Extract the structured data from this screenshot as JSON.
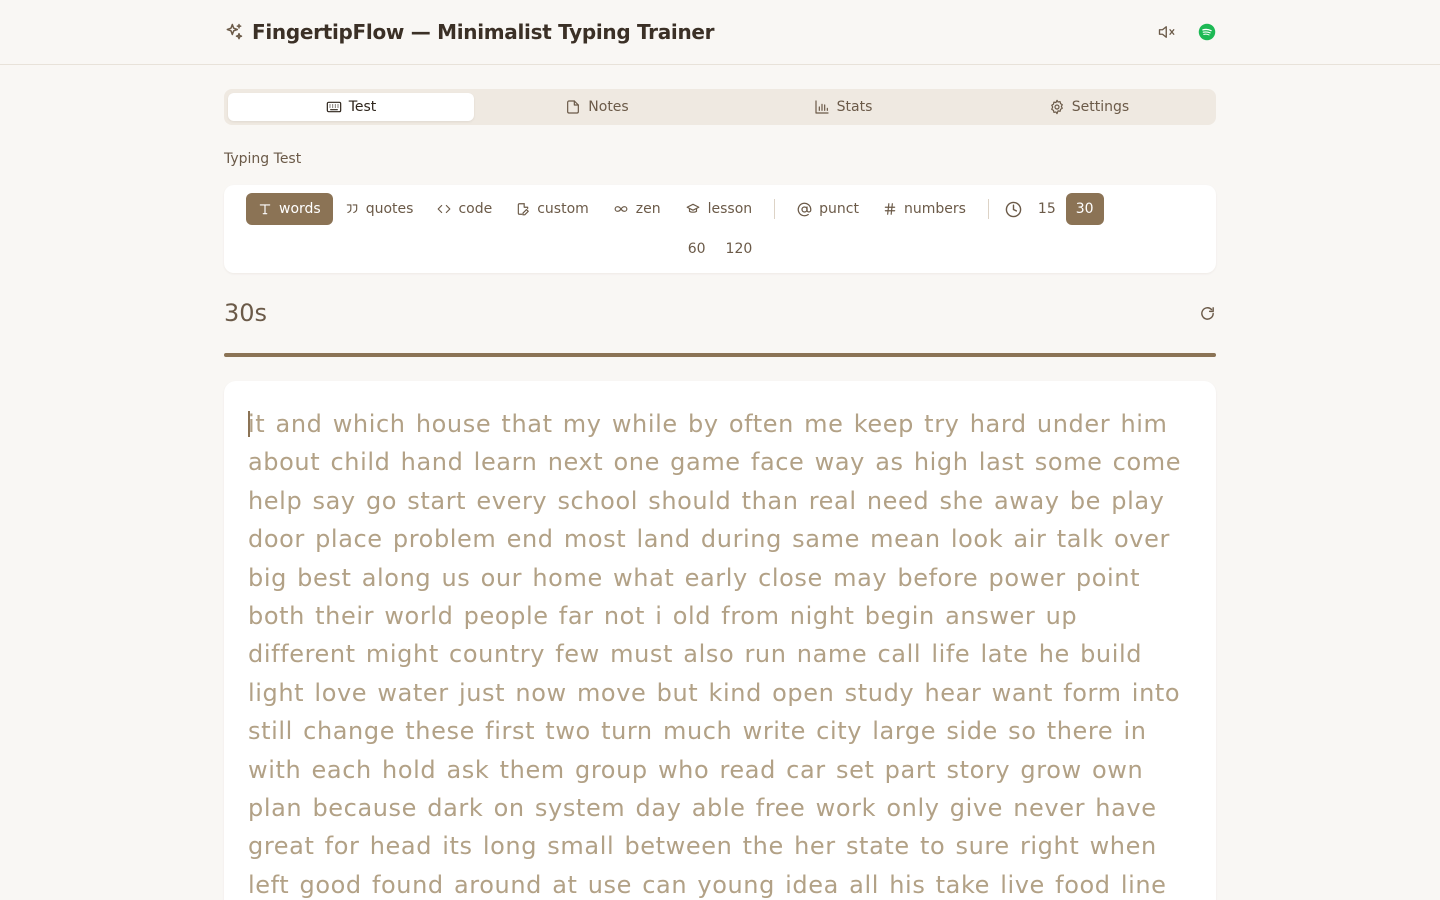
{
  "app": {
    "title": "FingertipFlow — Minimalist Typing Trainer"
  },
  "header": {
    "icons": [
      "sparkles-icon",
      "mute-icon",
      "spotify-icon"
    ],
    "colors": {
      "spotify": "#1db954"
    }
  },
  "tabs": [
    {
      "label": "Test",
      "icon": "keyboard-icon",
      "active": true
    },
    {
      "label": "Notes",
      "icon": "note-icon",
      "active": false
    },
    {
      "label": "Stats",
      "icon": "bar-chart-icon",
      "active": false
    },
    {
      "label": "Settings",
      "icon": "gear-icon",
      "active": false
    }
  ],
  "section_label": "Typing Test",
  "modes": [
    {
      "label": "words",
      "icon": "text-icon",
      "active": true
    },
    {
      "label": "quotes",
      "icon": "quote-icon",
      "active": false
    },
    {
      "label": "code",
      "icon": "code-icon",
      "active": false
    },
    {
      "label": "custom",
      "icon": "file-edit-icon",
      "active": false
    },
    {
      "label": "zen",
      "icon": "infinity-icon",
      "active": false
    },
    {
      "label": "lesson",
      "icon": "graduation-cap-icon",
      "active": false
    }
  ],
  "toggles": [
    {
      "label": "punct",
      "icon": "at-icon"
    },
    {
      "label": "numbers",
      "icon": "hash-icon"
    }
  ],
  "durations": {
    "options": [
      "15",
      "30",
      "60",
      "120"
    ],
    "selected": "30"
  },
  "timer": {
    "display": "30s",
    "progress": 1.0
  },
  "words": "it and which house that my while by often me keep try hard under him about child hand learn next one game face way as high last some come help say go start every school should than real need she away be play door place problem end most land during same mean look air talk over big best along us our home what early close may before power point both their world people far not i old from night begin answer up different might country few must also run name call life late he build light love water just now move but kind open study hear want form into still change these first two turn much write city large side so there in with each hold ask them group who read car set part story grow own plan because dark on system day able free work only give never have great for head its long small between the her state to sure right when left good found around at use can young idea all his take live food line other got know",
  "colors": {
    "accent": "#8b7355",
    "text_pending": "#b2a186",
    "background": "#f9f7f4"
  }
}
